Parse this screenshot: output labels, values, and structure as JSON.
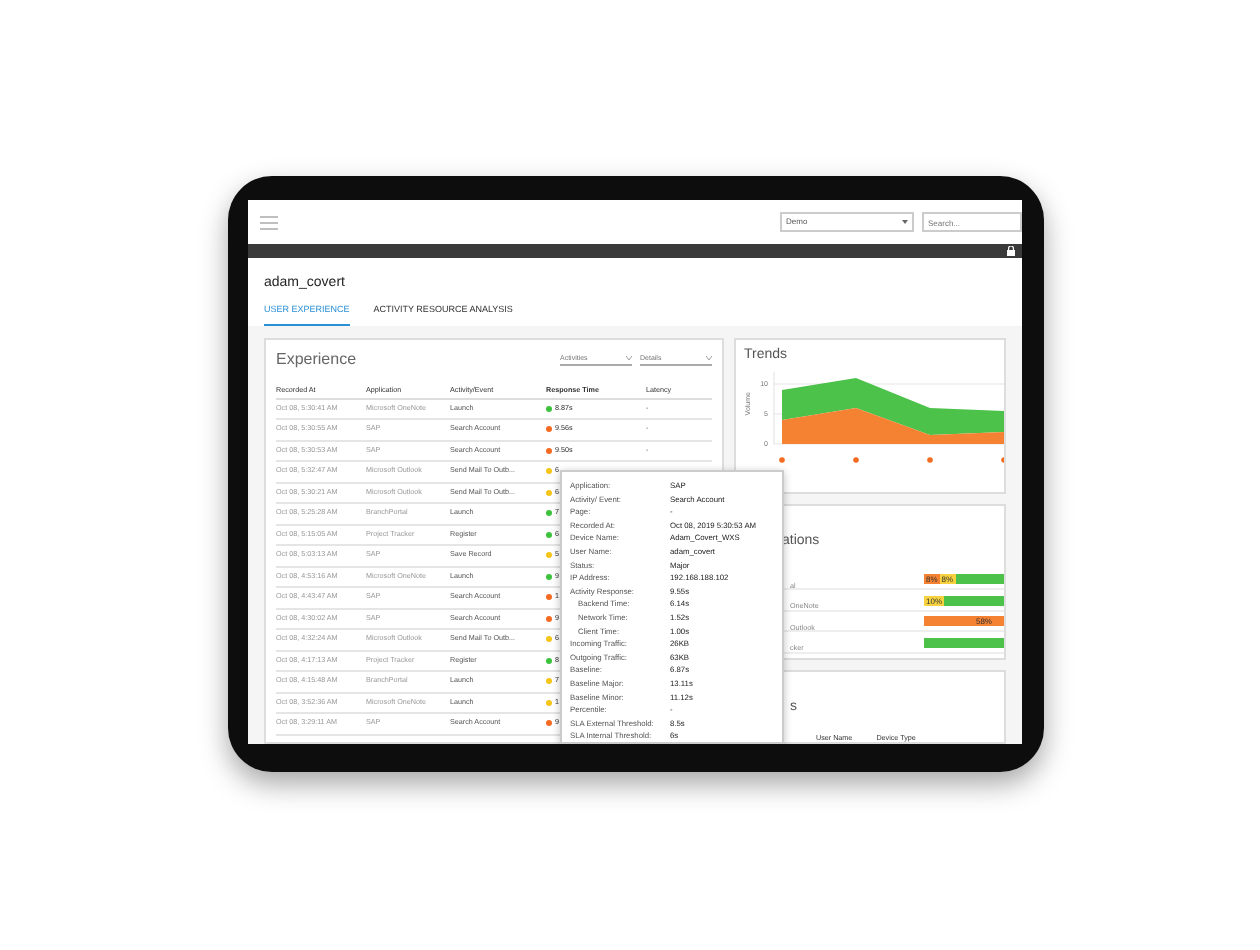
{
  "topbar": {
    "dropdown": "Demo",
    "search_placeholder": "Search..."
  },
  "user_title": "adam_covert",
  "tabs": [
    {
      "label": "USER EXPERIENCE",
      "selected": true
    },
    {
      "label": "ACTIVITY RESOURCE ANALYSIS",
      "selected": false
    }
  ],
  "experience": {
    "title": "Experience",
    "filters": [
      "Activities",
      "Details"
    ],
    "columns": [
      "Recorded At",
      "Application",
      "Activity/Event",
      "Response Time",
      "Latency"
    ],
    "rows": [
      {
        "recorded": "Oct 08, 5:30:41 AM",
        "application": "Microsoft OneNote",
        "activity": "Launch",
        "response": "8.87s",
        "color": "#3cc23c",
        "latency": "-"
      },
      {
        "recorded": "Oct 08, 5:30:55 AM",
        "application": "SAP",
        "activity": "Search Account",
        "response": "9.56s",
        "color": "#f26b21",
        "latency": "-"
      },
      {
        "recorded": "Oct 08, 5:30:53 AM",
        "application": "SAP",
        "activity": "Search Account",
        "response": "9.50s",
        "color": "#f26b21",
        "latency": "-"
      },
      {
        "recorded": "Oct 08, 5:32:47 AM",
        "application": "Microsoft Outlook",
        "activity": "Send Mail To Outb...",
        "response": "6",
        "color": "#f5c518"
      },
      {
        "recorded": "Oct 08, 5:30:21 AM",
        "application": "Microsoft Outlook",
        "activity": "Send Mail To Outb...",
        "response": "6",
        "color": "#f5c518"
      },
      {
        "recorded": "Oct 08, 5:25:28 AM",
        "application": "BranchPortal",
        "activity": "Launch",
        "response": "7",
        "color": "#3cc23c"
      },
      {
        "recorded": "Oct 08, 5:15:05 AM",
        "application": "Project Tracker",
        "activity": "Register",
        "response": "6",
        "color": "#3cc23c"
      },
      {
        "recorded": "Oct 08, 5:03:13 AM",
        "application": "SAP",
        "activity": "Save Record",
        "response": "5",
        "color": "#f5c518"
      },
      {
        "recorded": "Oct 08, 4:53:16 AM",
        "application": "Microsoft OneNote",
        "activity": "Launch",
        "response": "9",
        "color": "#3cc23c"
      },
      {
        "recorded": "Oct 08, 4:43:47 AM",
        "application": "SAP",
        "activity": "Search Account",
        "response": "1",
        "color": "#f26b21"
      },
      {
        "recorded": "Oct 08, 4:30:02 AM",
        "application": "SAP",
        "activity": "Search Account",
        "response": "9",
        "color": "#f26b21"
      },
      {
        "recorded": "Oct 08, 4:32:24 AM",
        "application": "Microsoft Outlook",
        "activity": "Send Mail To Outb...",
        "response": "6",
        "color": "#f5c518"
      },
      {
        "recorded": "Oct 08, 4:17:13 AM",
        "application": "Project Tracker",
        "activity": "Register",
        "response": "8",
        "color": "#3cc23c"
      },
      {
        "recorded": "Oct 08, 4:15:48 AM",
        "application": "BranchPortal",
        "activity": "Launch",
        "response": "7",
        "color": "#f5c518"
      },
      {
        "recorded": "Oct 08, 3:52:36 AM",
        "application": "Microsoft OneNote",
        "activity": "Launch",
        "response": "1",
        "color": "#f5c518"
      },
      {
        "recorded": "Oct 08, 3:29:11 AM",
        "application": "SAP",
        "activity": "Search Account",
        "response": "9",
        "color": "#f26b21"
      }
    ]
  },
  "tooltip": [
    {
      "label": "Application:",
      "value": "SAP"
    },
    {
      "label": "Activity/ Event:",
      "value": "Search Account"
    },
    {
      "label": "Page:",
      "value": "-"
    },
    {
      "label": "Recorded At:",
      "value": "Oct 08, 2019 5:30:53 AM"
    },
    {
      "label": "Device Name:",
      "value": "Adam_Covert_WXS"
    },
    {
      "label": "User Name:",
      "value": "adam_covert"
    },
    {
      "label": "Status:",
      "value": "Major"
    },
    {
      "label": "IP Address:",
      "value": "192.168.188.102"
    },
    {
      "label": "Activity Response:",
      "value": "9.55s",
      "children": [
        {
          "label": "Backend Time:",
          "value": "6.14s"
        },
        {
          "label": "Network Time:",
          "value": "1.52s"
        },
        {
          "label": "Client Time:",
          "value": "1.00s"
        }
      ]
    },
    {
      "label": "Incoming Traffic:",
      "value": "26KB"
    },
    {
      "label": "Outgoing Traffic:",
      "value": "63KB"
    },
    {
      "label": "Baseline:",
      "value": "6.87s"
    },
    {
      "label": "Baseline Major:",
      "value": "13.11s"
    },
    {
      "label": "Baseline Minor:",
      "value": "11.12s"
    },
    {
      "label": "Percentile:",
      "value": "-"
    },
    {
      "label": "SLA External Threshold:",
      "value": "8.5s"
    },
    {
      "label": "SLA Internal Threshold:",
      "value": "6s"
    }
  ],
  "trends": {
    "title": "Trends",
    "chart_data": {
      "type": "area",
      "stacked": true,
      "ylabel": "Volume",
      "yticks": [
        0,
        5,
        10
      ],
      "ylim": [
        0,
        12
      ],
      "series": [
        {
          "color": "#f58233",
          "values": [
            4,
            6,
            1.5,
            2
          ]
        },
        {
          "color": "#4cc24a",
          "values": [
            5,
            5,
            4.5,
            3.5
          ]
        }
      ]
    }
  },
  "locations": {
    "title": "ations",
    "rows": [
      {
        "label": "al",
        "segments": [
          {
            "color": "#f58233",
            "text": "8%"
          },
          {
            "color": "#f7d23e",
            "text": "8%"
          },
          {
            "color": "#4cc24a"
          }
        ]
      },
      {
        "label": "OneNote",
        "segments": [
          {
            "color": "#f7d23e",
            "text": "10%"
          },
          {
            "color": "#4cc24a"
          }
        ]
      },
      {
        "label": "Outlook",
        "segments": [
          {
            "color": "#f58233",
            "text": "58%"
          }
        ]
      },
      {
        "label": "cker",
        "segments": [
          {
            "color": "#4cc24a"
          }
        ]
      }
    ]
  },
  "bottom_panel": {
    "title": "s",
    "columns": [
      "User Name",
      "Device Type"
    ]
  }
}
